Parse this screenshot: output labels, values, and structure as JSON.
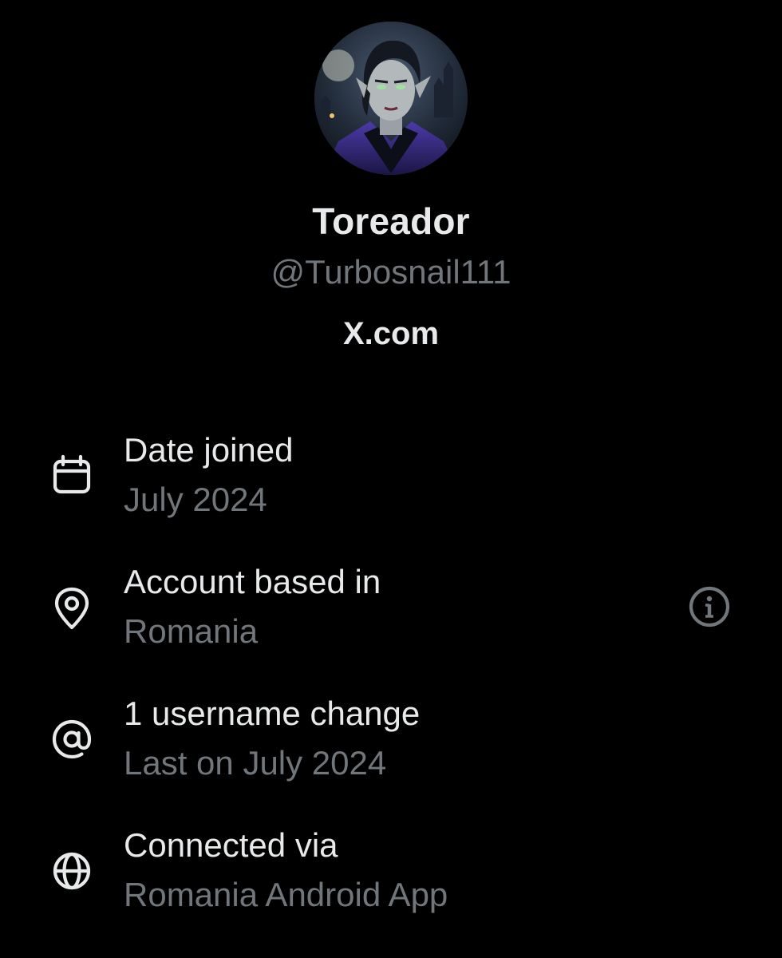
{
  "profile": {
    "display_name": "Toreador",
    "handle": "@Turbosnail111",
    "website": "X.com"
  },
  "details": [
    {
      "icon": "calendar-icon",
      "title": "Date joined",
      "subtitle": "July 2024"
    },
    {
      "icon": "location-pin-icon",
      "title": "Account based in",
      "subtitle": "Romania",
      "trailing_icon": "info-icon"
    },
    {
      "icon": "at-sign-icon",
      "title": "1 username change",
      "subtitle": "Last on July 2024"
    },
    {
      "icon": "globe-icon",
      "title": "Connected via",
      "subtitle": "Romania Android App"
    }
  ],
  "colors": {
    "background": "#000000",
    "primary_text": "#e7e9ea",
    "secondary_text": "#71767b"
  }
}
